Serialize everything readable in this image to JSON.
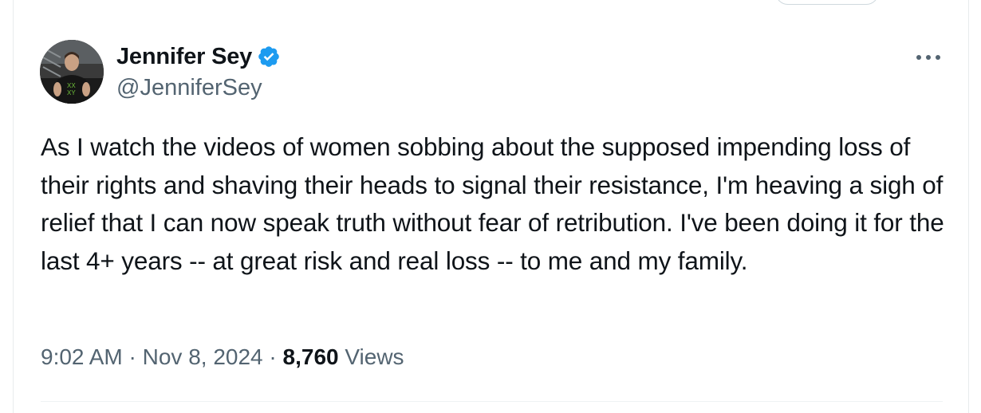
{
  "tweet": {
    "author": {
      "display_name": "Jennifer Sey",
      "handle": "@JenniferSey",
      "verified": true,
      "avatar_icon": "profile-photo"
    },
    "more_icon": "more-horizontal-icon",
    "text": "As I watch the videos of women sobbing about the supposed impending loss of their rights and shaving their heads to signal their resistance, I'm heaving a sigh of relief that I can now speak truth without fear of retribution. I've been doing it for the last 4+ years -- at great risk and real loss -- to me and my family.",
    "timestamp": {
      "time": "9:02 AM",
      "date": "Nov 8, 2024",
      "separator": "·"
    },
    "views": {
      "count": "8,760",
      "label": "Views"
    }
  },
  "colors": {
    "text_primary": "#0f1419",
    "text_secondary": "#536471",
    "verified_blue": "#1d9bf0",
    "divider": "#eff3f4"
  }
}
